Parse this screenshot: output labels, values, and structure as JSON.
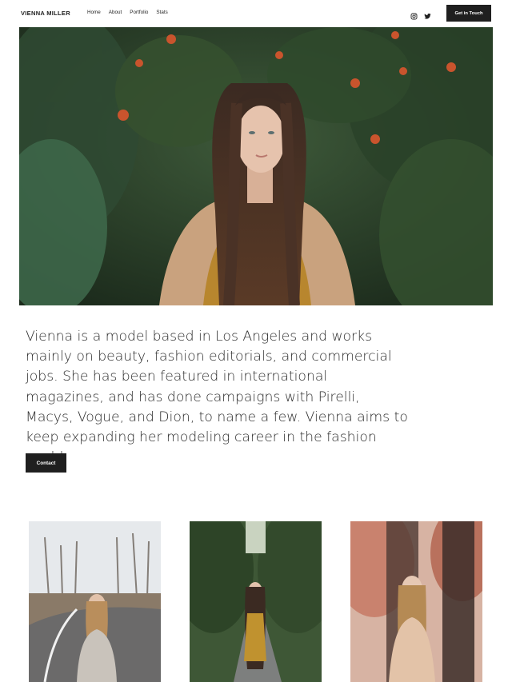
{
  "header": {
    "brand": "VIENNA MILLER",
    "nav": [
      "Home",
      "About",
      "Portfolio",
      "Stats"
    ],
    "social_icons": [
      "instagram-icon",
      "twitter-icon"
    ],
    "cta_label": "Get in Touch"
  },
  "intro": {
    "text": "Vienna is a model based in Los Angeles and works mainly on beauty, fashion editorials, and commercial jobs. She has been featured in international magazines, and has done campaigns with Pirelli, Macys, Vogue, and Dion, to name a few. Vienna aims to keep expanding her modeling career in the fashion world.",
    "contact_label": "Contact"
  },
  "colors": {
    "button_bg": "#1f1f1f",
    "text": "#2b2b2b",
    "background": "#ffffff"
  }
}
